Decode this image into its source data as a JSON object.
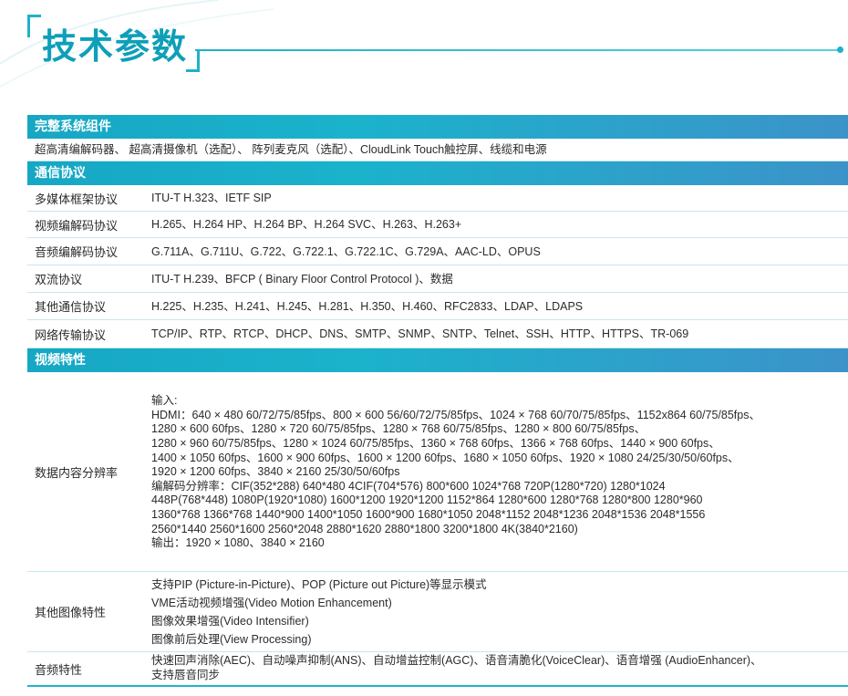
{
  "title": "技术参数",
  "sections": [
    {
      "heading": "完整系统组件",
      "full_text": "超高清编解码器、 超高清摄像机（选配）、 阵列麦克风（选配）、CloudLink Touch触控屏、线缆和电源"
    },
    {
      "heading": "通信协议",
      "rows": [
        {
          "label": "多媒体框架协议",
          "lines": [
            "ITU-T H.323、IETF SIP"
          ]
        },
        {
          "label": "视频编解码协议",
          "lines": [
            "H.265、H.264 HP、H.264 BP、H.264 SVC、H.263、H.263+"
          ]
        },
        {
          "label": "音频编解码协议",
          "lines": [
            "G.711A、G.711U、G.722、G.722.1、G.722.1C、G.729A、AAC-LD、OPUS"
          ]
        },
        {
          "label": "双流协议",
          "lines": [
            "ITU-T H.239、BFCP ( Binary Floor Control Protocol )、数据"
          ]
        },
        {
          "label": "其他通信协议",
          "lines": [
            "H.225、H.235、H.241、H.245、H.281、H.350、H.460、RFC2833、LDAP、LDAPS"
          ]
        },
        {
          "label": "网络传输协议",
          "lines": [
            "TCP/IP、RTP、RTCP、DHCP、DNS、SMTP、SNMP、SNTP、Telnet、SSH、HTTP、HTTPS、TR-069"
          ]
        }
      ]
    },
    {
      "heading": "视频特性",
      "rows": [
        {
          "label": "数据内容分辨率",
          "lines": [
            "输入:",
            "HDMI：640 × 480 60/72/75/85fps、800 × 600 56/60/72/75/85fps、1024 × 768 60/70/75/85fps、1152x864 60/75/85fps、",
            "1280 × 600 60fps、1280 × 720 60/75/85fps、1280 × 768 60/75/85fps、1280 × 800 60/75/85fps、",
            "1280 × 960 60/75/85fps、1280 × 1024 60/75/85fps、1360 × 768 60fps、1366 × 768 60fps、1440 × 900 60fps、",
            "1400 × 1050 60fps、1600 × 900 60fps、1600 × 1200 60fps、1680 × 1050 60fps、1920 × 1080 24/25/30/50/60fps、",
            "1920 × 1200 60fps、3840 × 2160 25/30/50/60fps",
            "编解码分辨率：CIF(352*288) 640*480 4CIF(704*576) 800*600 1024*768 720P(1280*720) 1280*1024",
            "448P(768*448) 1080P(1920*1080) 1600*1200 1920*1200 1152*864 1280*600 1280*768 1280*800 1280*960",
            "1360*768 1366*768 1440*900 1400*1050 1600*900 1680*1050 2048*1152 2048*1236 2048*1536 2048*1556",
            "2560*1440 2560*1600 2560*2048 2880*1620 2880*1800 3200*1800 4K(3840*2160)",
            "输出：1920 × 1080、3840 × 2160"
          ]
        },
        {
          "label": "其他图像特性",
          "lines": [
            "支持PIP (Picture-in-Picture)、POP (Picture out Picture)等显示模式",
            "VME活动视频增强(Video Motion Enhancement)",
            "图像效果增强(Video Intensifier)",
            "图像前后处理(View Processing)"
          ]
        },
        {
          "label": "音频特性",
          "lines": [
            "快速回声消除(AEC)、自动噪声抑制(ANS)、自动增益控制(AGC)、语音清脆化(VoiceClear)、语音增强 (AudioEnhancer)、",
            "支持唇音同步"
          ]
        }
      ]
    }
  ],
  "colors": {
    "accent": "#0e9fb9",
    "header_bar": "#16a7c4",
    "row_divider": "#c6e8ee"
  }
}
